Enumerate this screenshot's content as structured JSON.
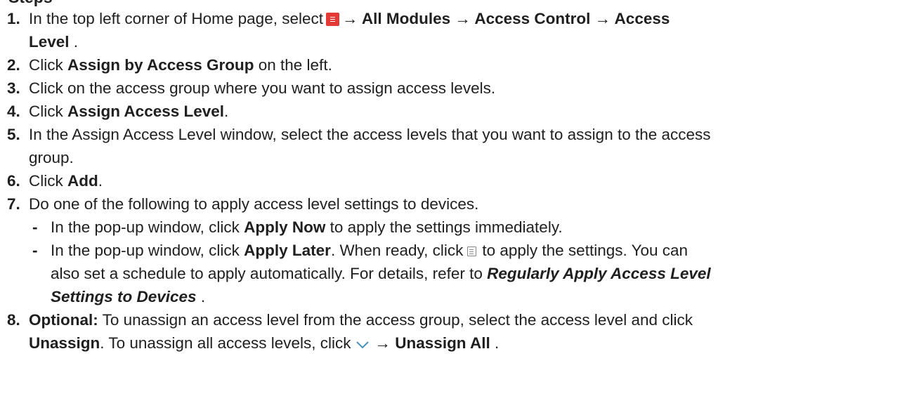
{
  "heading": "Steps",
  "steps": [
    {
      "num": "1.",
      "parts": {
        "a": "In the top left corner of Home page, select",
        "b": "→ All Modules → Access Control → Access",
        "c": "Level",
        "d": " ."
      }
    },
    {
      "num": "2.",
      "parts": {
        "a": "Click ",
        "b": "Assign by Access Group",
        "c": " on the left."
      }
    },
    {
      "num": "3.",
      "parts": {
        "a": "Click on the access group where you want to assign access levels."
      }
    },
    {
      "num": "4.",
      "parts": {
        "a": "Click ",
        "b": "Assign Access Level",
        "c": "."
      }
    },
    {
      "num": "5.",
      "parts": {
        "a": "In the Assign Access Level window, select the access levels that you want to assign to the access",
        "b": "group."
      }
    },
    {
      "num": "6.",
      "parts": {
        "a": "Click ",
        "b": "Add",
        "c": "."
      }
    },
    {
      "num": "7.",
      "parts": {
        "a": "Do one of the following to apply access level settings to devices."
      }
    },
    {
      "num": "8.",
      "parts": {
        "a": "Optional:",
        "b": " To unassign an access level from the access group, select the access level and click",
        "c": "Unassign",
        "d": ". To unassign all access levels, click",
        "e": "→ Unassign All",
        "f": " ."
      }
    }
  ],
  "bullets": [
    {
      "dash": "-",
      "parts": {
        "a": "In the pop-up window, click ",
        "b": "Apply Now",
        "c": " to apply the settings immediately."
      }
    },
    {
      "dash": "-",
      "parts": {
        "a": "In the pop-up window, click ",
        "b": "Apply Later",
        "c": ". When ready, click",
        "d": "to apply the settings. You can",
        "e": "also set a schedule to apply automatically. For details, refer to ",
        "f": "Regularly Apply Access Level",
        "g": "Settings to Devices",
        "h": " ."
      }
    }
  ],
  "icons": {
    "menu": "menu-icon",
    "apply": "apply-settings-icon",
    "chevron": "chevron-down-icon",
    "menu_color": "#e53935"
  }
}
